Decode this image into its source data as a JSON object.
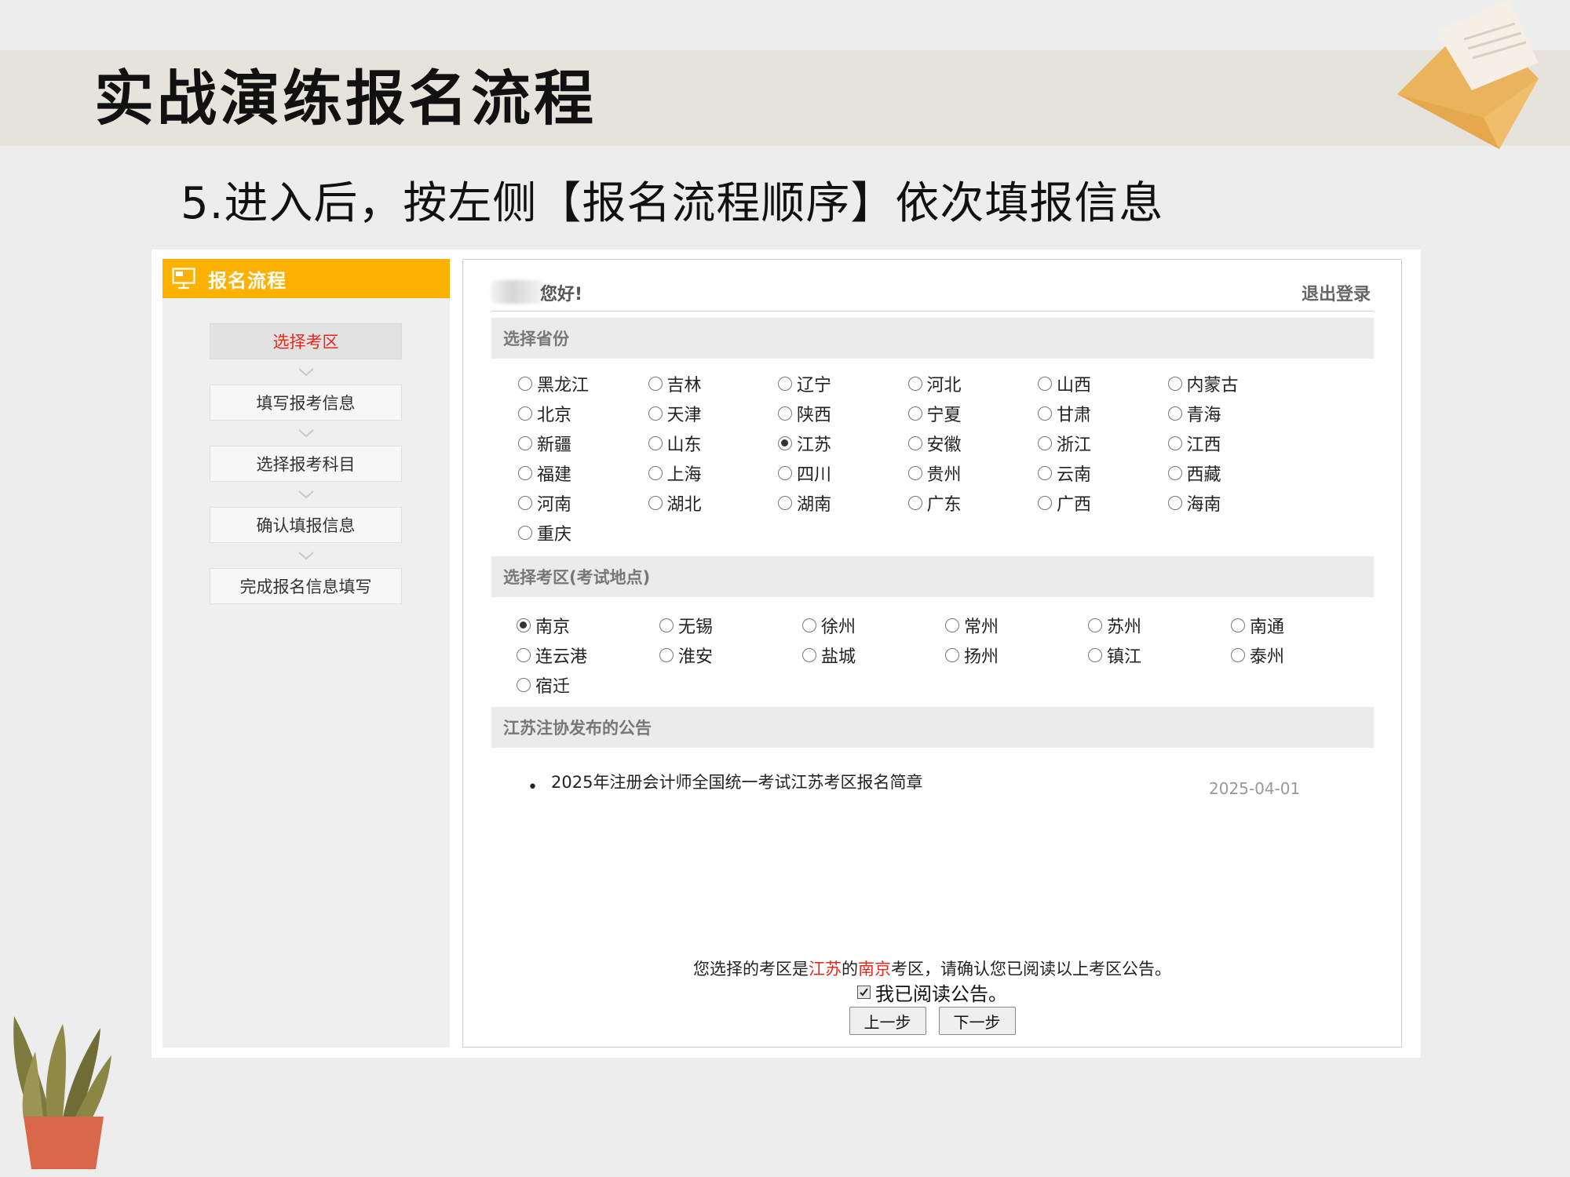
{
  "slide": {
    "title": "实战演练报名流程",
    "subtitle": "5.进入后，按左侧【报名流程顺序】依次填报信息"
  },
  "sidebar": {
    "header": "报名流程",
    "steps": [
      "选择考区",
      "填写报考信息",
      "选择报考科目",
      "确认填报信息",
      "完成报名信息填写"
    ],
    "active_step": 0
  },
  "topbar": {
    "greeting": "您好!",
    "logout": "退出登录"
  },
  "province_section": {
    "header": "选择省份",
    "options": [
      "黑龙江",
      "吉林",
      "辽宁",
      "河北",
      "山西",
      "内蒙古",
      "北京",
      "天津",
      "陕西",
      "宁夏",
      "甘肃",
      "青海",
      "新疆",
      "山东",
      "江苏",
      "安徽",
      "浙江",
      "江西",
      "福建",
      "上海",
      "四川",
      "贵州",
      "云南",
      "西藏",
      "河南",
      "湖北",
      "湖南",
      "广东",
      "广西",
      "海南",
      "重庆"
    ],
    "selected": "江苏"
  },
  "area_section": {
    "header": "选择考区(考试地点)",
    "options": [
      "南京",
      "无锡",
      "徐州",
      "常州",
      "苏州",
      "南通",
      "连云港",
      "淮安",
      "盐城",
      "扬州",
      "镇江",
      "泰州",
      "宿迁"
    ],
    "selected": "南京"
  },
  "notice_section": {
    "header": "江苏注协发布的公告",
    "items": [
      {
        "bullet": "•",
        "title": "2025年注册会计师全国统一考试江苏考区报名简章",
        "date": "2025-04-01"
      }
    ]
  },
  "confirm": {
    "prefix": "您选择的考区是",
    "province": "江苏",
    "mid": "的",
    "area": "南京",
    "suffix": "考区，请确认您已阅读以上考区公告。",
    "read_label": "我已阅读公告。",
    "read_checked": true
  },
  "buttons": {
    "prev": "上一步",
    "next": "下一步"
  },
  "colors": {
    "sidebar_header": "#fdb100",
    "active_step_text": "#e8281f",
    "highlight_text": "#e8281f"
  }
}
